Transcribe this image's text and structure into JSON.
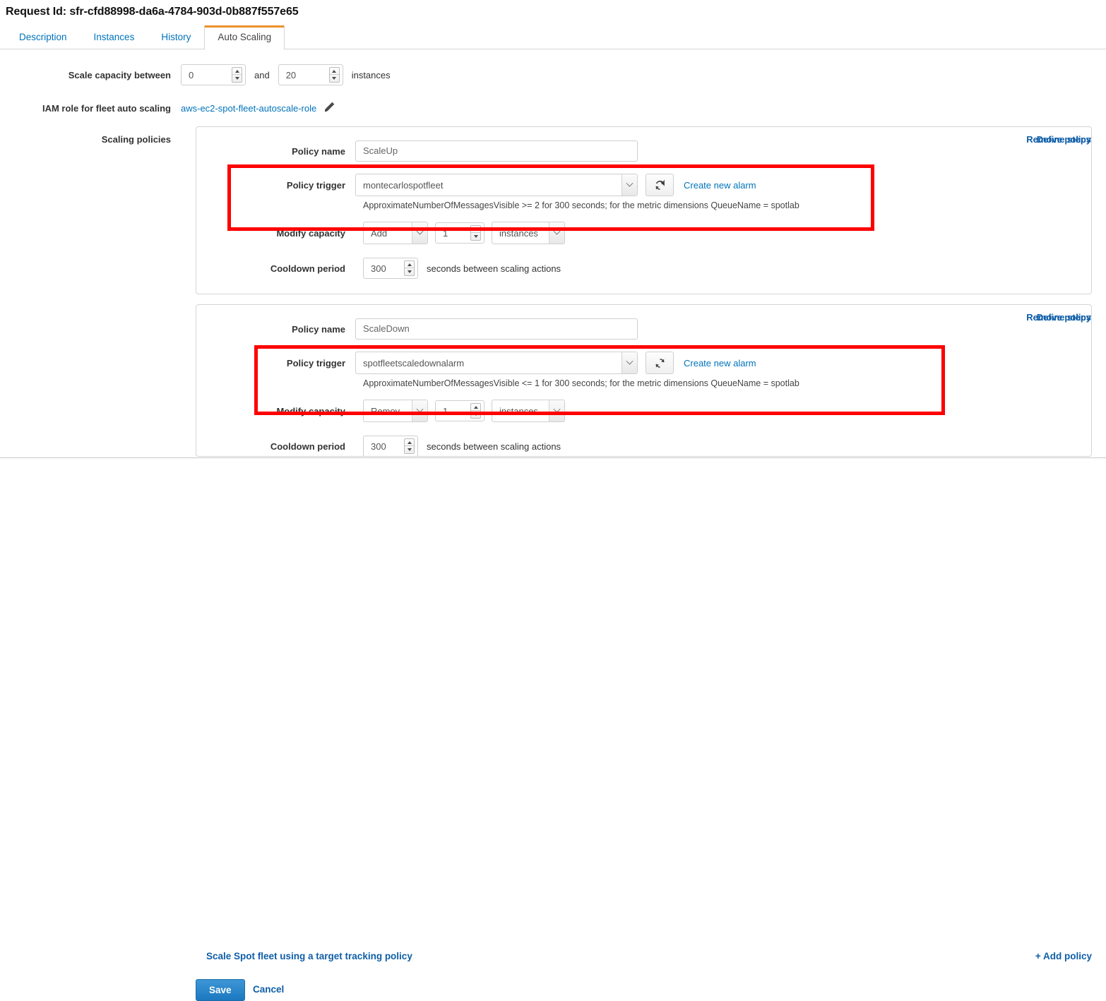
{
  "header": {
    "request_id_label": "Request Id:",
    "request_id": "sfr-cfd88998-da6a-4784-903d-0b887f557e65",
    "title_full": "Request Id: sfr-cfd88998-da6a-4784-903d-0b887f557e65"
  },
  "tabs": [
    {
      "label": "Description",
      "active": false
    },
    {
      "label": "Instances",
      "active": false
    },
    {
      "label": "History",
      "active": false
    },
    {
      "label": "Auto Scaling",
      "active": true
    }
  ],
  "capacity": {
    "label": "Scale capacity between",
    "min": "0",
    "and": "and",
    "max": "20",
    "unit": "instances"
  },
  "iam": {
    "label": "IAM role for fleet auto scaling",
    "role": "aws-ec2-spot-fleet-autoscale-role",
    "edit_icon": "pencil-icon"
  },
  "scaling_policies_label": "Scaling policies",
  "labels": {
    "policy_name": "Policy name",
    "policy_trigger": "Policy trigger",
    "modify_capacity": "Modify capacity",
    "cooldown_period": "Cooldown period",
    "cooldown_suffix": "seconds between scaling actions",
    "remove_policy": "Remove policy",
    "define_steps": "Define steps",
    "create_new_alarm": "Create new alarm",
    "refresh_icon": "refresh-icon"
  },
  "policies": [
    {
      "name": "ScaleUp",
      "trigger": "montecarlospotfleet",
      "alarm_description": "ApproximateNumberOfMessagesVisible >= 2 for 300 seconds; for the metric dimensions QueueName = spotlab",
      "action": "Add",
      "amount": "1",
      "unit": "instances",
      "cooldown": "300"
    },
    {
      "name": "ScaleDown",
      "trigger": "spotfleetscaledownalarm",
      "alarm_description": "ApproximateNumberOfMessagesVisible <= 1 for 300 seconds; for the metric dimensions QueueName = spotlab",
      "action": "Remov",
      "amount": "1",
      "unit": "instances",
      "cooldown": "300"
    }
  ],
  "footer": {
    "target_tracking_link": "Scale Spot fleet using a target tracking policy",
    "add_policy_link": "+ Add policy",
    "save_label": "Save",
    "cancel_label": "Cancel"
  },
  "colors": {
    "accent_orange": "#ec912d",
    "link_blue": "#0073bb",
    "bold_link_blue": "#0f5ea8",
    "annotation_red": "#fe0000",
    "save_button_blue": "#2887ca"
  }
}
